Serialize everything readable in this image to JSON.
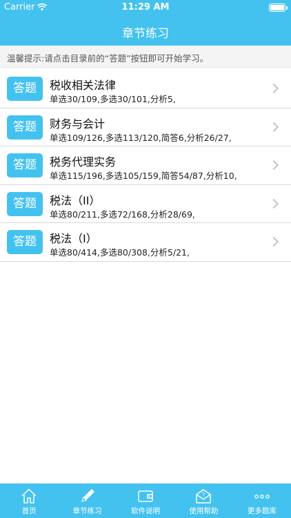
{
  "status_bar": {
    "carrier": "Carrier",
    "time": "11:29 AM"
  },
  "header": {
    "title": "章节练习"
  },
  "hint": "温馨提示:请点击目录前的“答题”按钮即可开始学习。",
  "chapters": [
    {
      "button": "答题",
      "title": "税收相关法律",
      "stats": "单选30/109,多选30/101,分析5,"
    },
    {
      "button": "答题",
      "title": "财务与会计",
      "stats": "单选109/126,多选113/120,简答6,分析26/27,"
    },
    {
      "button": "答题",
      "title": "税务代理实务",
      "stats": "单选115/196,多选105/159,简答54/87,分析10,"
    },
    {
      "button": "答题",
      "title": "税法（II）",
      "stats": "单选80/211,多选72/168,分析28/69,"
    },
    {
      "button": "答题",
      "title": "税法（I）",
      "stats": "单选80/414,多选80/308,分析5/21,"
    }
  ],
  "tabbar": [
    {
      "label": "首页",
      "icon": "home-icon"
    },
    {
      "label": "章节练习",
      "icon": "pencil-icon"
    },
    {
      "label": "软件说明",
      "icon": "wallet-icon"
    },
    {
      "label": "使用帮助",
      "icon": "help-envelope-icon"
    },
    {
      "label": "更多题库",
      "icon": "more-icon"
    }
  ],
  "colors": {
    "accent": "#44c2ef",
    "hint_background": "#f4f4f4"
  }
}
